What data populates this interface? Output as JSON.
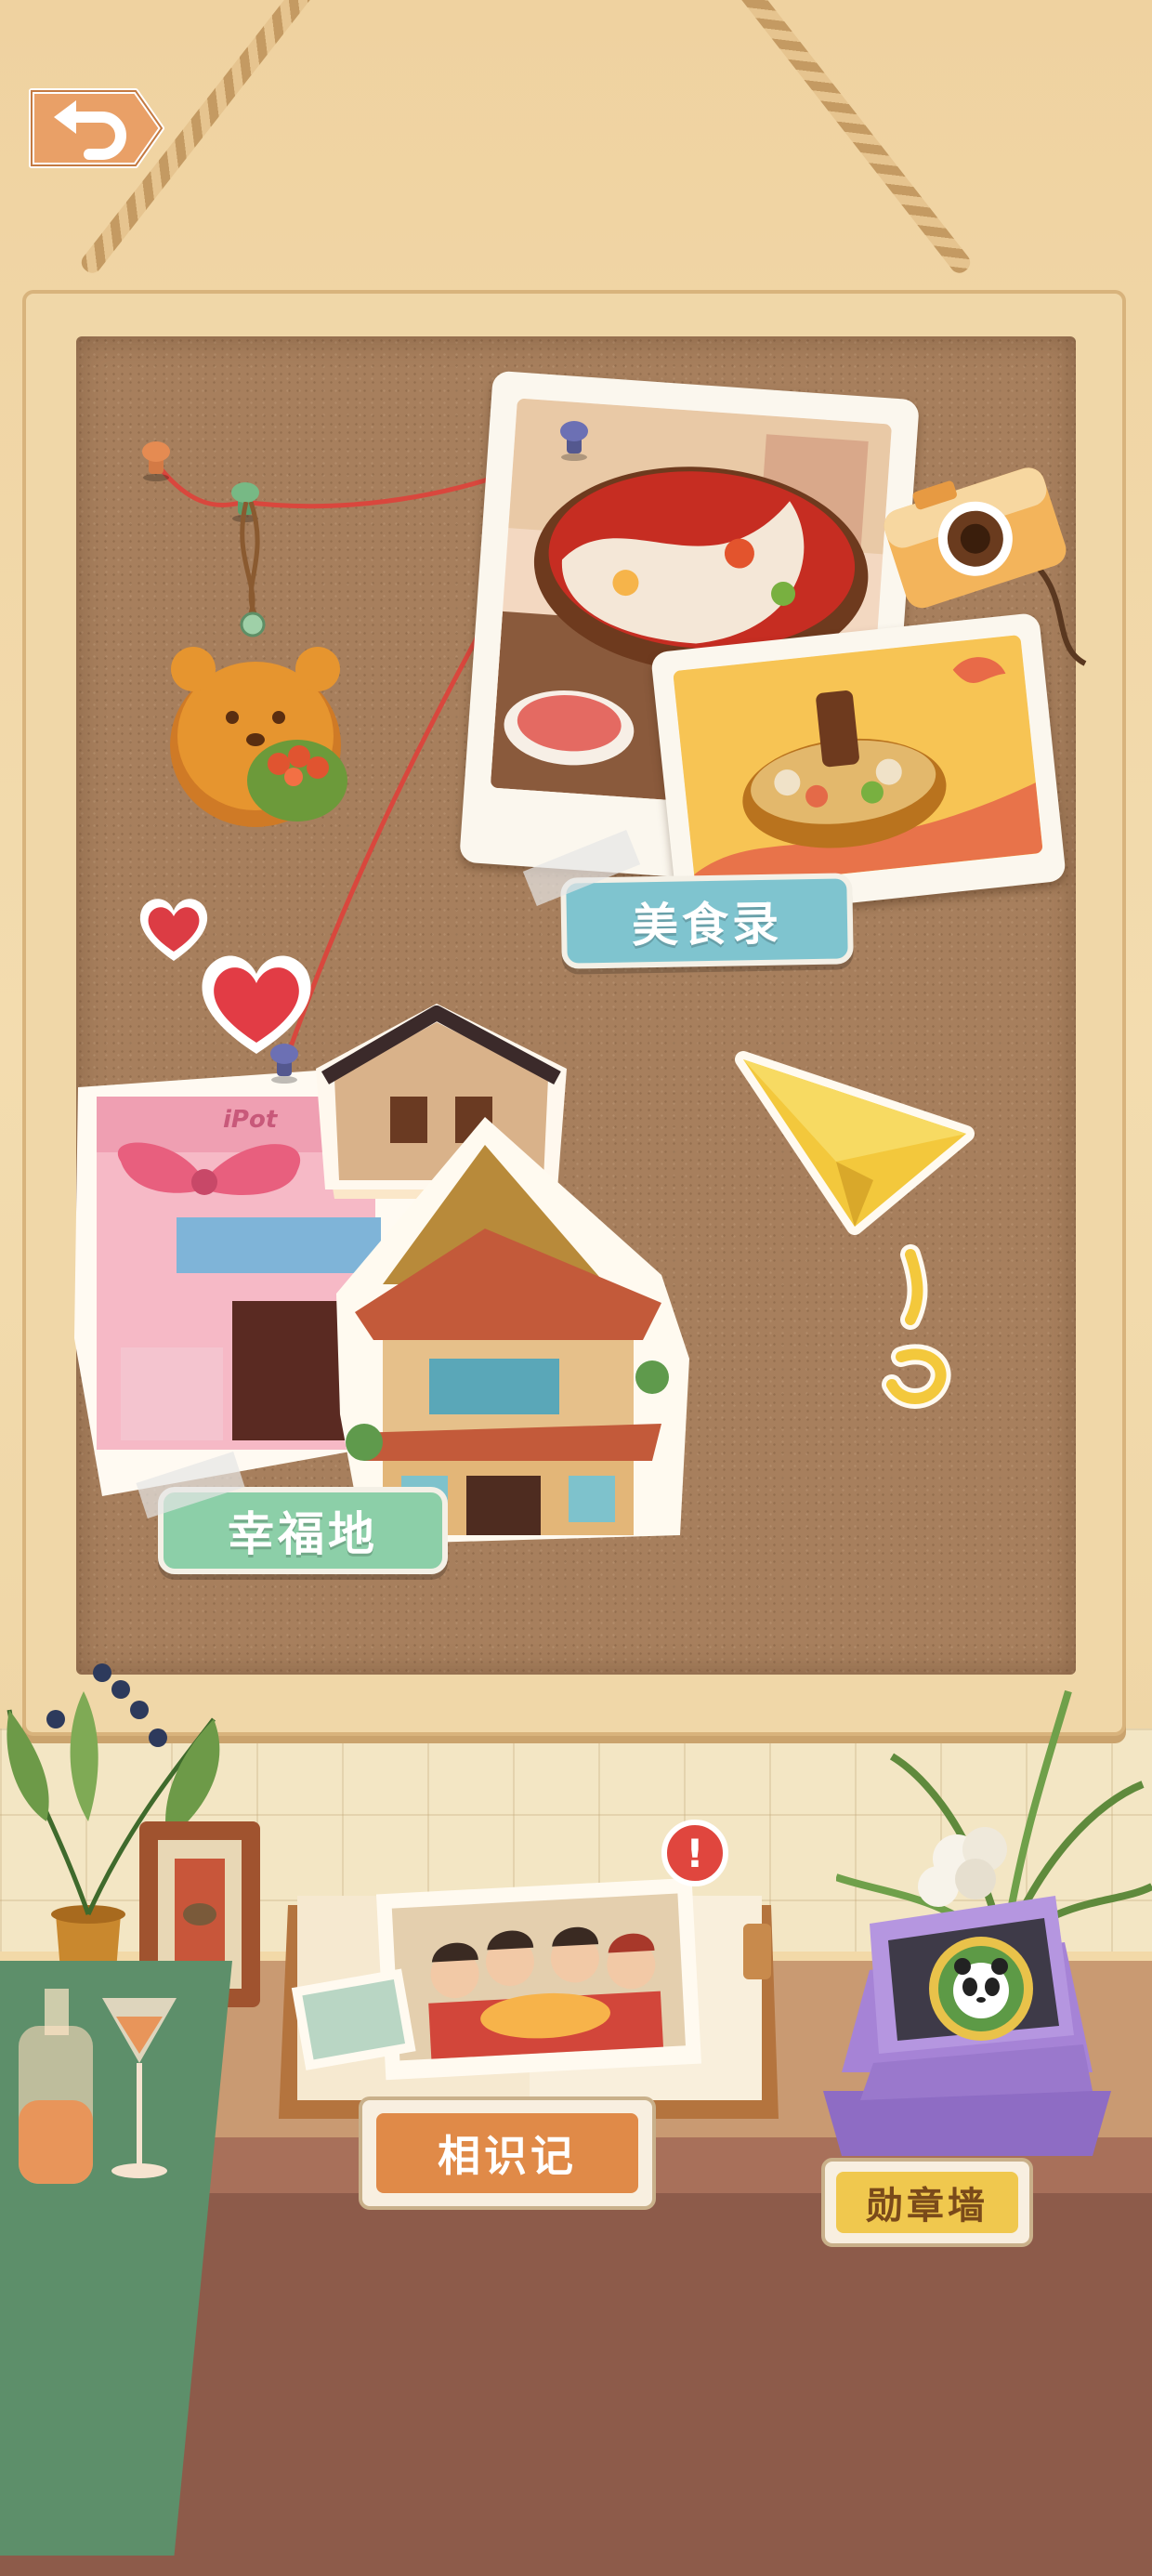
{
  "navigation": {
    "back_icon": "curved-back-arrow-icon"
  },
  "board": {
    "food_label": "美食录",
    "place_label": "幸福地",
    "restaurant_sign": "iPot"
  },
  "desk": {
    "album_label": "相识记",
    "medal_label": "勋章墙",
    "alert_mark": "!"
  },
  "colors": {
    "food_tag": "#7fc4cf",
    "place_tag": "#8ccfa8",
    "album_tag": "#e08a48",
    "medal_tag": "#f0c84e",
    "string": "#d9473d"
  }
}
